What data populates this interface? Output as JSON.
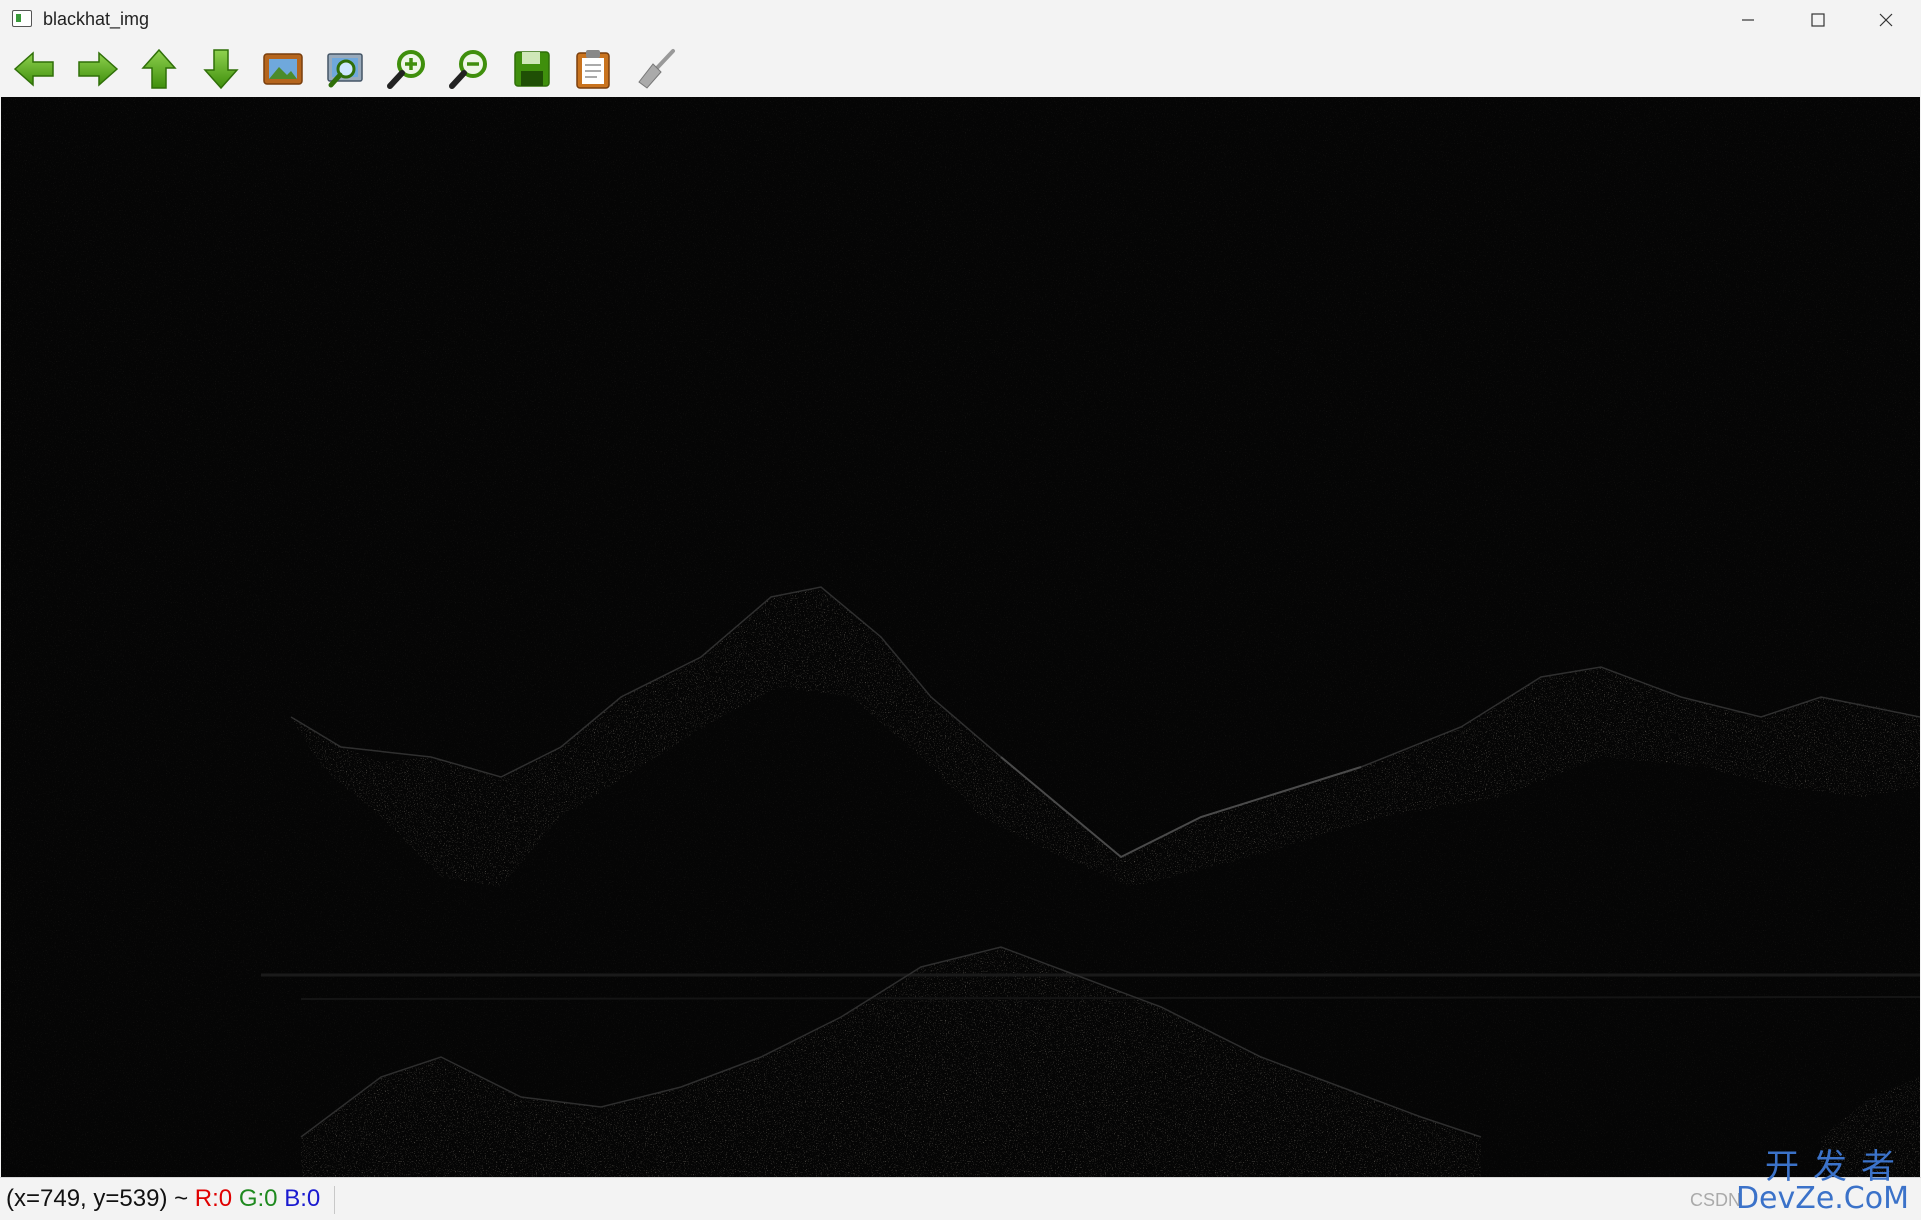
{
  "window": {
    "title": "blackhat_img",
    "controls": [
      "minimize",
      "maximize",
      "close"
    ]
  },
  "toolbar": {
    "buttons": [
      {
        "name": "pan-left",
        "icon": "arrow-left-icon"
      },
      {
        "name": "pan-right",
        "icon": "arrow-right-icon"
      },
      {
        "name": "pan-up",
        "icon": "arrow-up-icon"
      },
      {
        "name": "pan-down",
        "icon": "arrow-down-icon"
      },
      {
        "name": "zoom-original",
        "icon": "picture-icon"
      },
      {
        "name": "zoom-fit",
        "icon": "picture-magnifier-icon"
      },
      {
        "name": "zoom-in",
        "icon": "zoom-in-icon"
      },
      {
        "name": "zoom-out",
        "icon": "zoom-out-icon"
      },
      {
        "name": "save",
        "icon": "save-icon"
      },
      {
        "name": "copy-clipboard",
        "icon": "clipboard-icon"
      },
      {
        "name": "properties",
        "icon": "brush-icon"
      }
    ],
    "accent_color": "#4a9a12"
  },
  "status": {
    "coords": "(x=749, y=539) ~",
    "r": "R:0",
    "g": "G:0",
    "b": "B:0"
  },
  "watermark": {
    "top": "开发者",
    "bottom": "DevZe.CoM",
    "left": "CSDN"
  }
}
